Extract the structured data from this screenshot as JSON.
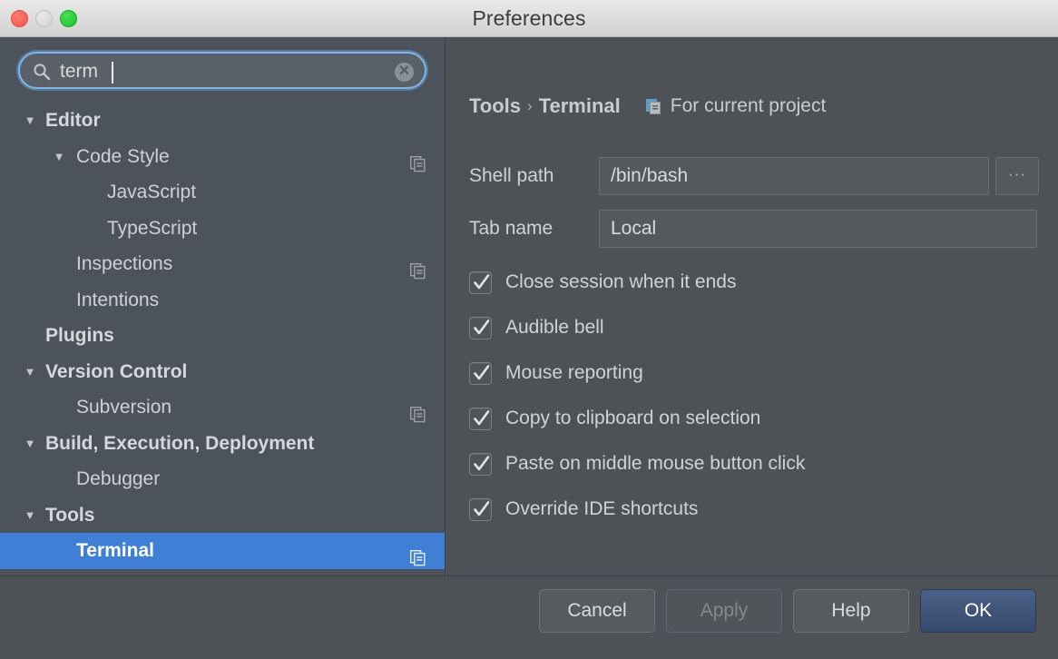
{
  "window": {
    "title": "Preferences",
    "controls": [
      {
        "name": "close",
        "color": "#f9564c"
      },
      {
        "name": "minimize",
        "color": "#d4d4d4"
      },
      {
        "name": "maximize",
        "color": "#17c42a"
      }
    ]
  },
  "colors": {
    "sidebar_bg": "#4c535c",
    "panel_bg": "#4e5256",
    "selection_blue": "#3f7fd6",
    "focus_ring": "#7fb4e8",
    "primary_button": "#35496b",
    "text": "#d0d3d5"
  },
  "search": {
    "value": "term",
    "placeholder": "Search",
    "icon": "search-icon",
    "clear_icon": "clear-icon",
    "clear_label": "✕"
  },
  "tree": {
    "items": [
      {
        "label": "Editor",
        "level": 0,
        "expanded": true,
        "bold": true,
        "arrow": "▼",
        "scope_icon": false,
        "selected": false
      },
      {
        "label": "Code Style",
        "level": 1,
        "expanded": true,
        "bold": false,
        "arrow": "▼",
        "scope_icon": true,
        "selected": false
      },
      {
        "label": "JavaScript",
        "level": 2,
        "expanded": false,
        "bold": false,
        "arrow": "",
        "scope_icon": false,
        "selected": false
      },
      {
        "label": "TypeScript",
        "level": 2,
        "expanded": false,
        "bold": false,
        "arrow": "",
        "scope_icon": false,
        "selected": false
      },
      {
        "label": "Inspections",
        "level": 1,
        "expanded": false,
        "bold": false,
        "arrow": "",
        "scope_icon": true,
        "selected": false
      },
      {
        "label": "Intentions",
        "level": 1,
        "expanded": false,
        "bold": false,
        "arrow": "",
        "scope_icon": false,
        "selected": false
      },
      {
        "label": "Plugins",
        "level": 0,
        "expanded": false,
        "bold": true,
        "arrow": "",
        "scope_icon": false,
        "selected": false
      },
      {
        "label": "Version Control",
        "level": 0,
        "expanded": true,
        "bold": true,
        "arrow": "▼",
        "scope_icon": false,
        "selected": false
      },
      {
        "label": "Subversion",
        "level": 1,
        "expanded": false,
        "bold": false,
        "arrow": "",
        "scope_icon": true,
        "selected": false
      },
      {
        "label": "Build, Execution, Deployment",
        "level": 0,
        "expanded": true,
        "bold": true,
        "arrow": "▼",
        "scope_icon": false,
        "selected": false
      },
      {
        "label": "Debugger",
        "level": 1,
        "expanded": false,
        "bold": false,
        "arrow": "",
        "scope_icon": false,
        "selected": false
      },
      {
        "label": "Tools",
        "level": 0,
        "expanded": true,
        "bold": true,
        "arrow": "▼",
        "scope_icon": false,
        "selected": false
      },
      {
        "label": "Terminal",
        "level": 1,
        "expanded": false,
        "bold": true,
        "arrow": "",
        "scope_icon": true,
        "selected": true
      }
    ]
  },
  "detail": {
    "breadcrumb": {
      "parent": "Tools",
      "separator": "›",
      "current": "Terminal"
    },
    "scope_note": {
      "icon": "project-scope-icon",
      "text": "For current project"
    },
    "fields": [
      {
        "label": "Shell path",
        "value": "/bin/bash",
        "browse_label": "···"
      },
      {
        "label": "Tab name",
        "value": "Local"
      }
    ],
    "checkboxes": [
      {
        "label": "Close session when it ends",
        "checked": true
      },
      {
        "label": "Audible bell",
        "checked": true
      },
      {
        "label": "Mouse reporting",
        "checked": true
      },
      {
        "label": "Copy to clipboard on selection",
        "checked": true
      },
      {
        "label": "Paste on middle mouse button click",
        "checked": true
      },
      {
        "label": "Override IDE shortcuts",
        "checked": true
      }
    ]
  },
  "footer": {
    "buttons": [
      {
        "label": "Cancel",
        "style": "normal"
      },
      {
        "label": "Apply",
        "style": "disabled"
      },
      {
        "label": "Help",
        "style": "normal"
      },
      {
        "label": "OK",
        "style": "primary"
      }
    ]
  }
}
